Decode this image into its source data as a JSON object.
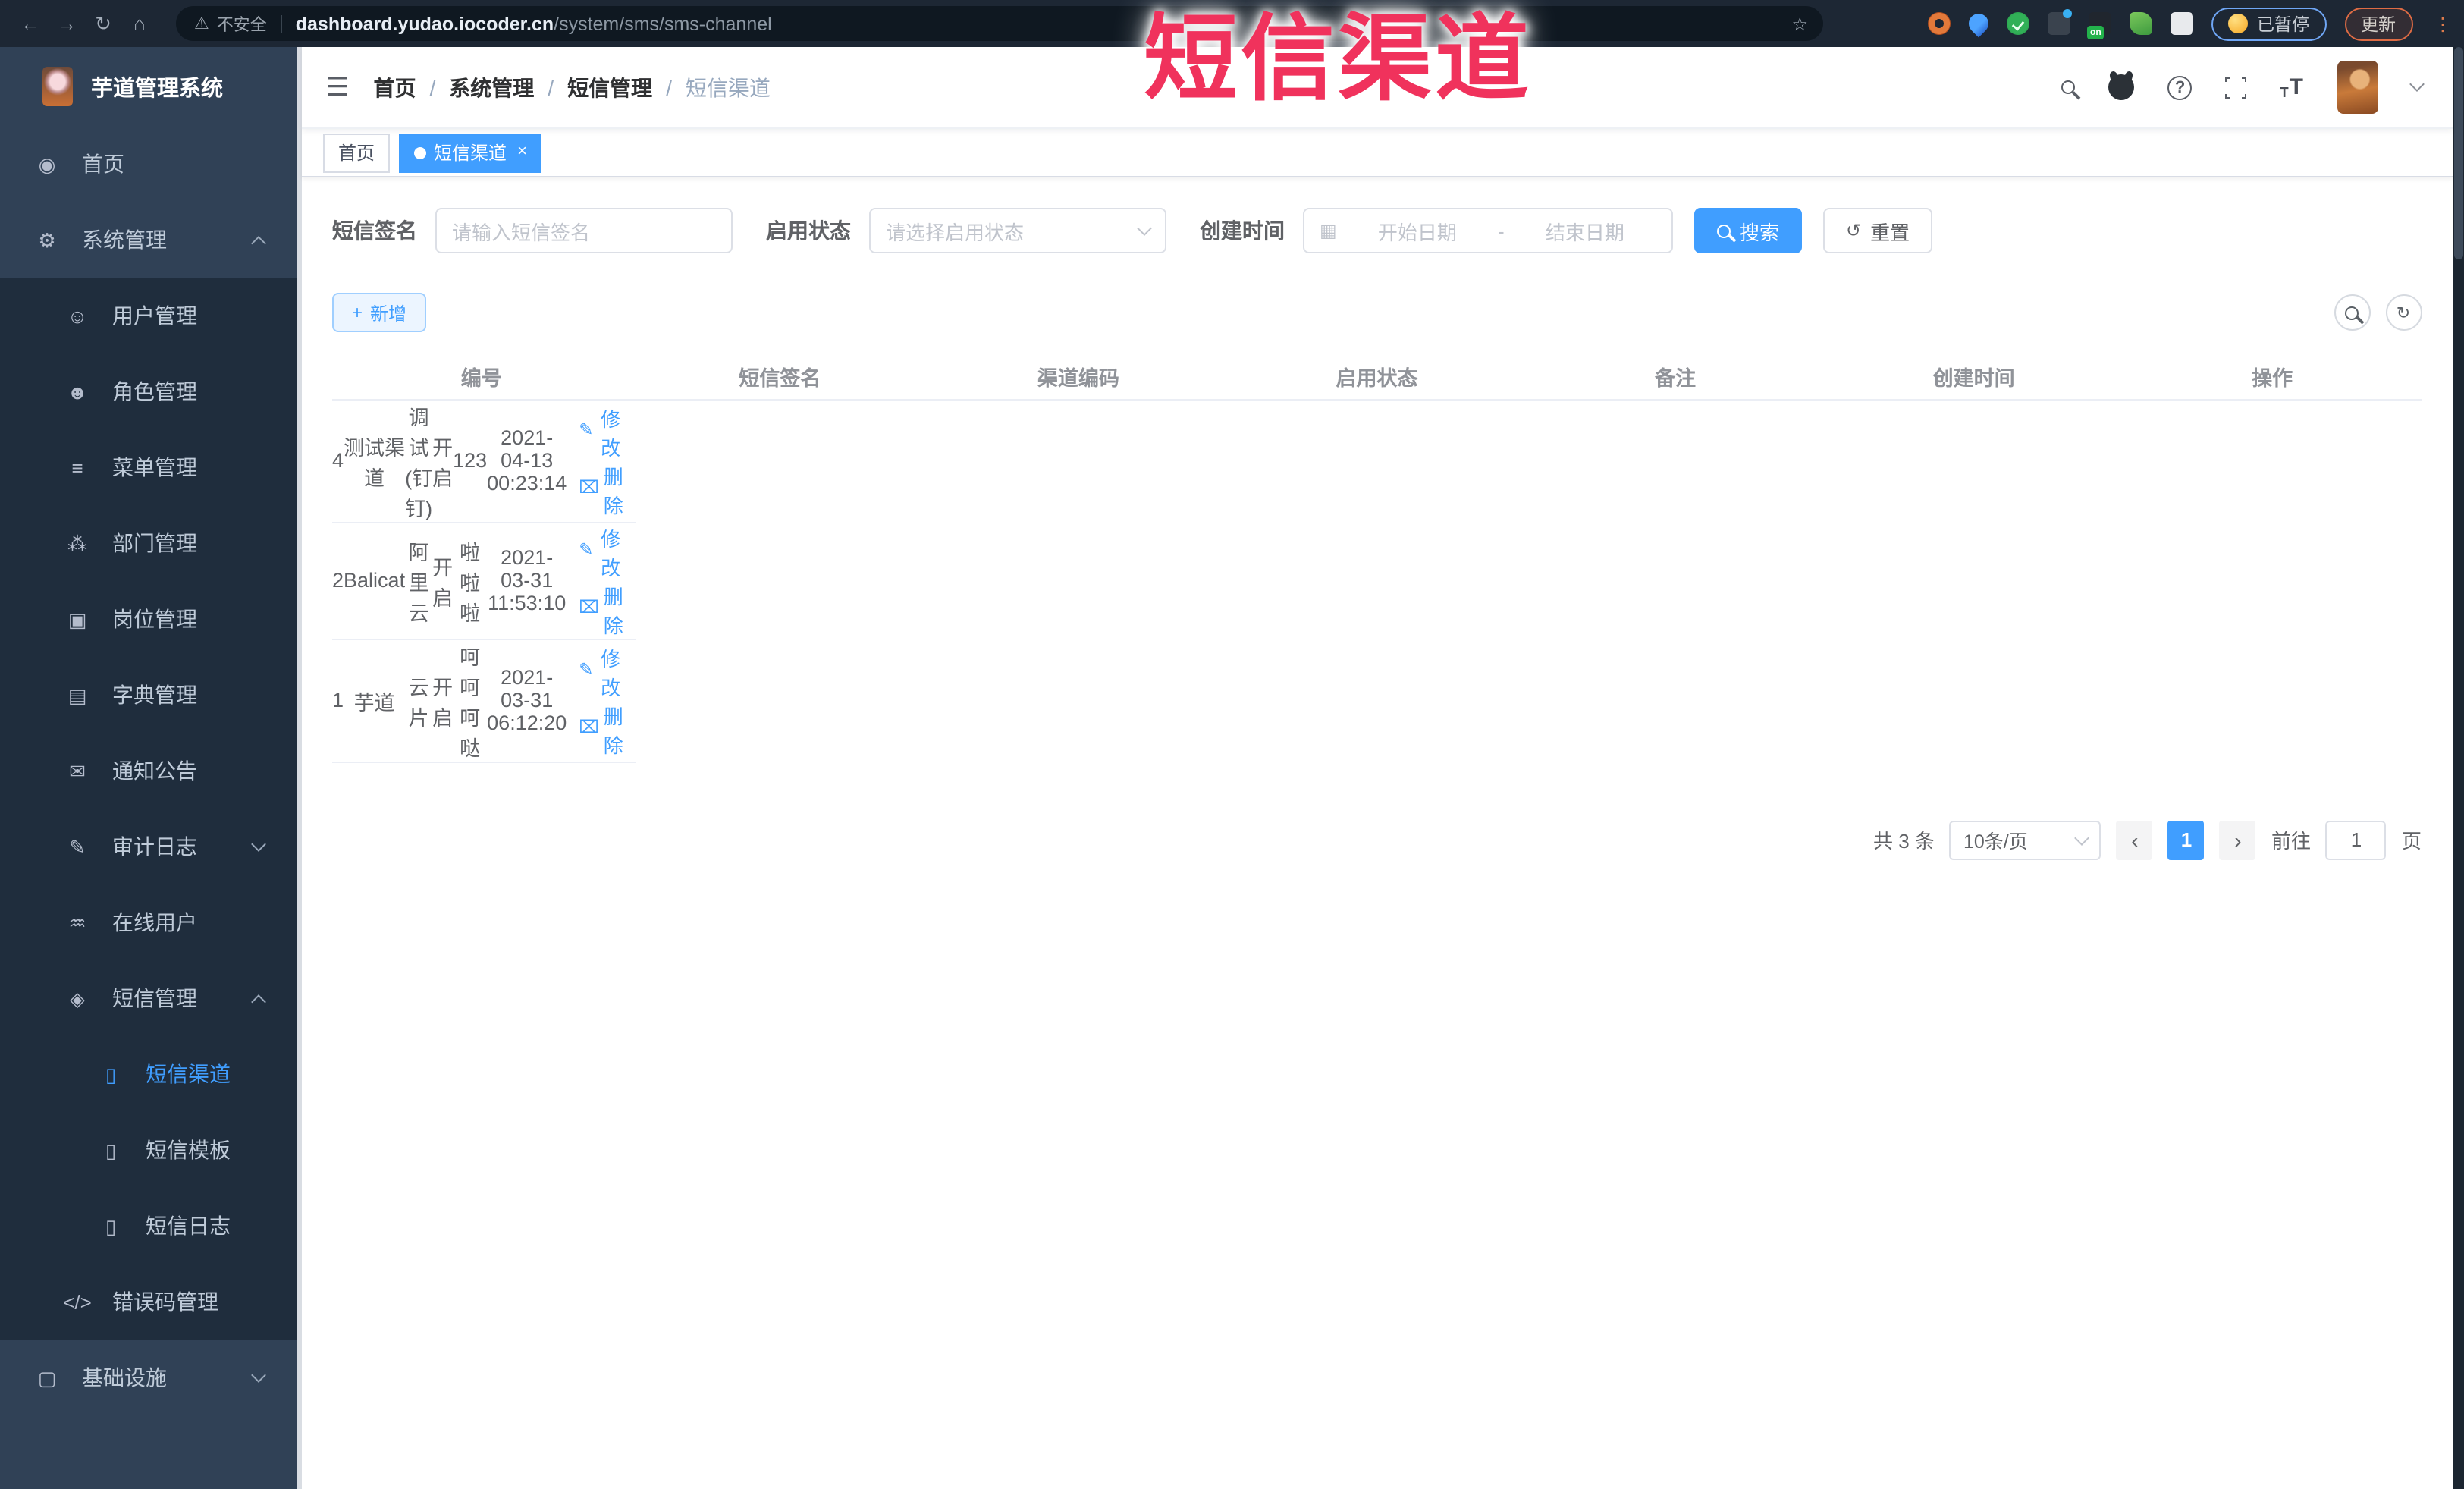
{
  "overlay_title": "短信渠道",
  "browser": {
    "security_label": "不安全",
    "host": "dashboard.yudao.iocoder.cn",
    "path": "/system/sms/sms-channel",
    "paused_label": "已暂停",
    "update_label": "更新",
    "on_badge": "on"
  },
  "icons": {
    "back": "←",
    "forward": "→",
    "reload": "↻",
    "home": "⌂",
    "warning": "⚠",
    "star": "☆",
    "ellipsis": "⋮",
    "hamburger": "☰",
    "question": "?",
    "calendar": "▦",
    "reset": "↺",
    "add": "+",
    "edit": "✎",
    "delete": "⌧",
    "refresh": "↻",
    "prev": "‹",
    "next": "›",
    "close": "×",
    "range_sep": "-"
  },
  "sidebar": {
    "logo_title": "芋道管理系统",
    "items": [
      {
        "key": "home",
        "label": "首页",
        "icon": "dashboard-icon",
        "level": 1
      },
      {
        "key": "system-management",
        "label": "系统管理",
        "icon": "gear-icon",
        "level": 1,
        "arrow": "up"
      },
      {
        "key": "user-management",
        "label": "用户管理",
        "icon": "user-icon",
        "level": 2
      },
      {
        "key": "role-management",
        "label": "角色管理",
        "icon": "users-icon",
        "level": 2
      },
      {
        "key": "menu-management",
        "label": "菜单管理",
        "icon": "menu-list-icon",
        "level": 2
      },
      {
        "key": "dept-management",
        "label": "部门管理",
        "icon": "org-tree-icon",
        "level": 2
      },
      {
        "key": "post-management",
        "label": "岗位管理",
        "icon": "post-badge-icon",
        "level": 2
      },
      {
        "key": "dict-management",
        "label": "字典管理",
        "icon": "dictionary-icon",
        "level": 2
      },
      {
        "key": "notice-announcement",
        "label": "通知公告",
        "icon": "announcement-icon",
        "level": 2
      },
      {
        "key": "audit-log",
        "label": "审计日志",
        "icon": "audit-log-icon",
        "level": 2,
        "arrow": "down"
      },
      {
        "key": "online-users",
        "label": "在线用户",
        "icon": "online-users-icon",
        "level": 2
      },
      {
        "key": "sms-management",
        "label": "短信管理",
        "icon": "sms-shield-icon",
        "level": 2,
        "arrow": "up"
      },
      {
        "key": "sms-channel",
        "label": "短信渠道",
        "icon": "phone-icon",
        "level": 3,
        "active": true
      },
      {
        "key": "sms-template",
        "label": "短信模板",
        "icon": "phone-icon",
        "level": 3
      },
      {
        "key": "sms-log",
        "label": "短信日志",
        "icon": "phone-icon",
        "level": 3
      },
      {
        "key": "error-code-management",
        "label": "错误码管理",
        "icon": "code-icon",
        "level": 2
      },
      {
        "key": "infrastructure",
        "label": "基础设施",
        "icon": "monitor-icon",
        "level": 1,
        "arrow": "down"
      }
    ]
  },
  "navbar": {
    "breadcrumb": [
      "首页",
      "系统管理",
      "短信管理",
      "短信渠道"
    ],
    "separator": "/"
  },
  "tabs": [
    {
      "label": "首页",
      "active": false
    },
    {
      "label": "短信渠道",
      "active": true
    }
  ],
  "search_form": {
    "sign_label": "短信签名",
    "sign_placeholder": "请输入短信签名",
    "status_label": "启用状态",
    "status_placeholder": "请选择启用状态",
    "time_label": "创建时间",
    "start_placeholder": "开始日期",
    "end_placeholder": "结束日期",
    "search_button": "搜索",
    "reset_button": "重置"
  },
  "toolbar": {
    "add_button": "新增"
  },
  "table": {
    "headers": [
      "编号",
      "短信签名",
      "渠道编码",
      "启用状态",
      "备注",
      "创建时间",
      "操作"
    ],
    "rows": [
      {
        "id": "4",
        "sign": "测试渠道",
        "code": "调试(钉钉)",
        "status": "开启",
        "remark": "123",
        "created": "2021-04-13 00:23:14"
      },
      {
        "id": "2",
        "sign": "Balicat",
        "code": "阿里云",
        "status": "开启",
        "remark": "啦啦啦",
        "created": "2021-03-31 11:53:10"
      },
      {
        "id": "1",
        "sign": "芋道",
        "code": "云片",
        "status": "开启",
        "remark": "呵呵呵哒",
        "created": "2021-03-31 06:12:20"
      }
    ],
    "edit_label": "修改",
    "delete_label": "删除"
  },
  "pagination": {
    "total_text": "共 3 条",
    "page_size": "10条/页",
    "current_page": "1",
    "goto_label": "前往",
    "goto_value": "1",
    "page_unit": "页"
  },
  "colors": {
    "primary": "#409eff",
    "sidebar_bg": "#304156",
    "submenu_bg": "#1f2d3d",
    "overlay_red": "#f0325c",
    "chrome_bg": "#1d2734"
  }
}
